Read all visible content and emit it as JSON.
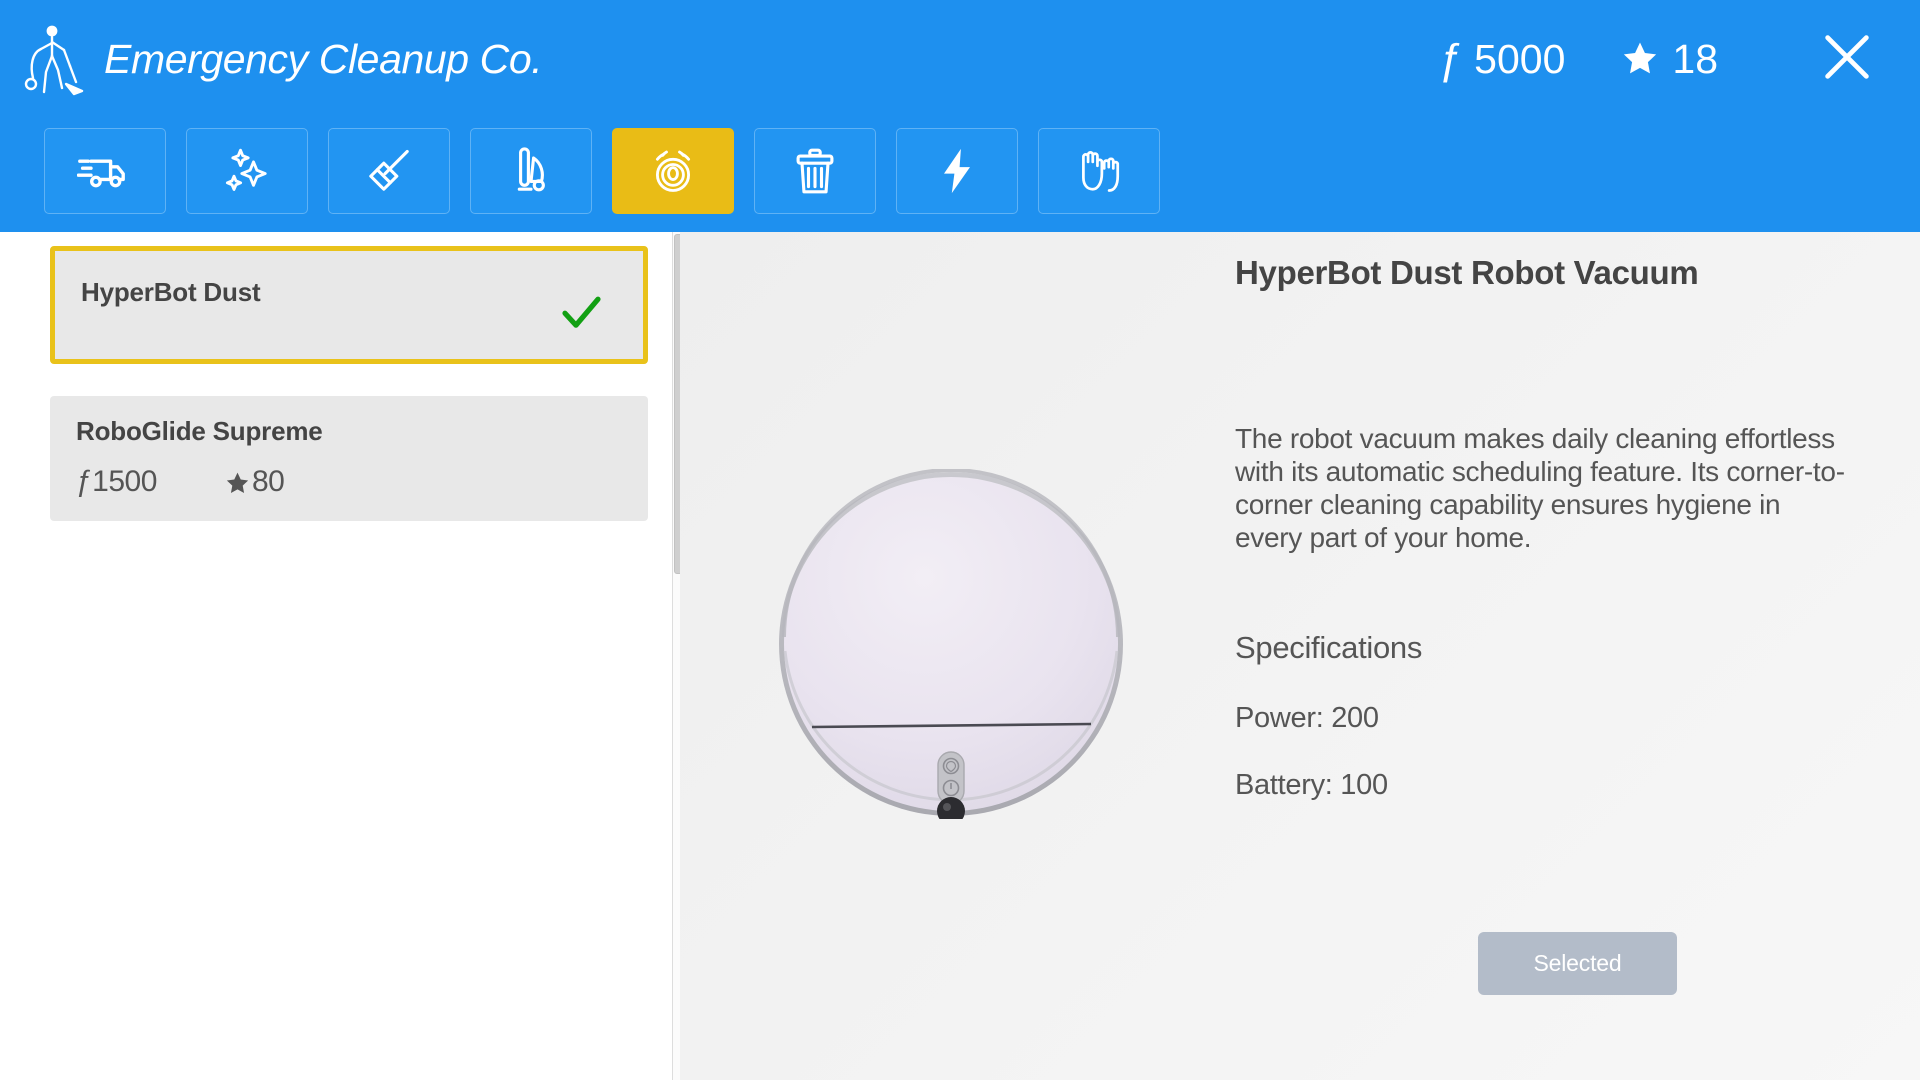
{
  "header": {
    "logo_icon": "person-vacuuming-icon",
    "title": "Emergency Cleanup Co.",
    "currency_symbol": "ƒ",
    "money": "5000",
    "star_icon": "star-icon",
    "stars": "18",
    "close_icon": "close-icon",
    "brand_color": "#1e90ef",
    "accent_color": "#e9bc16"
  },
  "toolbar": {
    "items": [
      {
        "icon": "delivery-truck-icon",
        "name": "delivery",
        "active": false
      },
      {
        "icon": "sparkles-icon",
        "name": "sparkle-clean",
        "active": false
      },
      {
        "icon": "broom-icon",
        "name": "broom",
        "active": false
      },
      {
        "icon": "vacuum-cleaner-icon",
        "name": "vacuum-cleaner",
        "active": false
      },
      {
        "icon": "robot-vacuum-icon",
        "name": "robot-vacuum",
        "active": true
      },
      {
        "icon": "trash-can-icon",
        "name": "trash",
        "active": false
      },
      {
        "icon": "lightning-bolt-icon",
        "name": "power",
        "active": false
      },
      {
        "icon": "gloves-icon",
        "name": "gloves",
        "active": false
      }
    ]
  },
  "list": {
    "items": [
      {
        "name": "HyperBot Dust",
        "selected": true,
        "check_icon": "check-icon",
        "price": "",
        "rating": ""
      },
      {
        "name": "RoboGlide Supreme",
        "selected": false,
        "price": "ƒ1500",
        "rating": "80",
        "star_icon": "star-icon"
      }
    ]
  },
  "detail": {
    "title": "HyperBot Dust Robot Vacuum",
    "product_image": "robot-vacuum-photo",
    "description": "The robot vacuum makes daily cleaning effortless with its automatic scheduling feature. Its corner-to-corner cleaning capability ensures hygiene in every part of your home.",
    "spec_heading": "Specifications",
    "specs": [
      {
        "label": "Power: 200"
      },
      {
        "label": "Battery: 100"
      }
    ],
    "action_label": "Selected",
    "action_disabled": true
  }
}
